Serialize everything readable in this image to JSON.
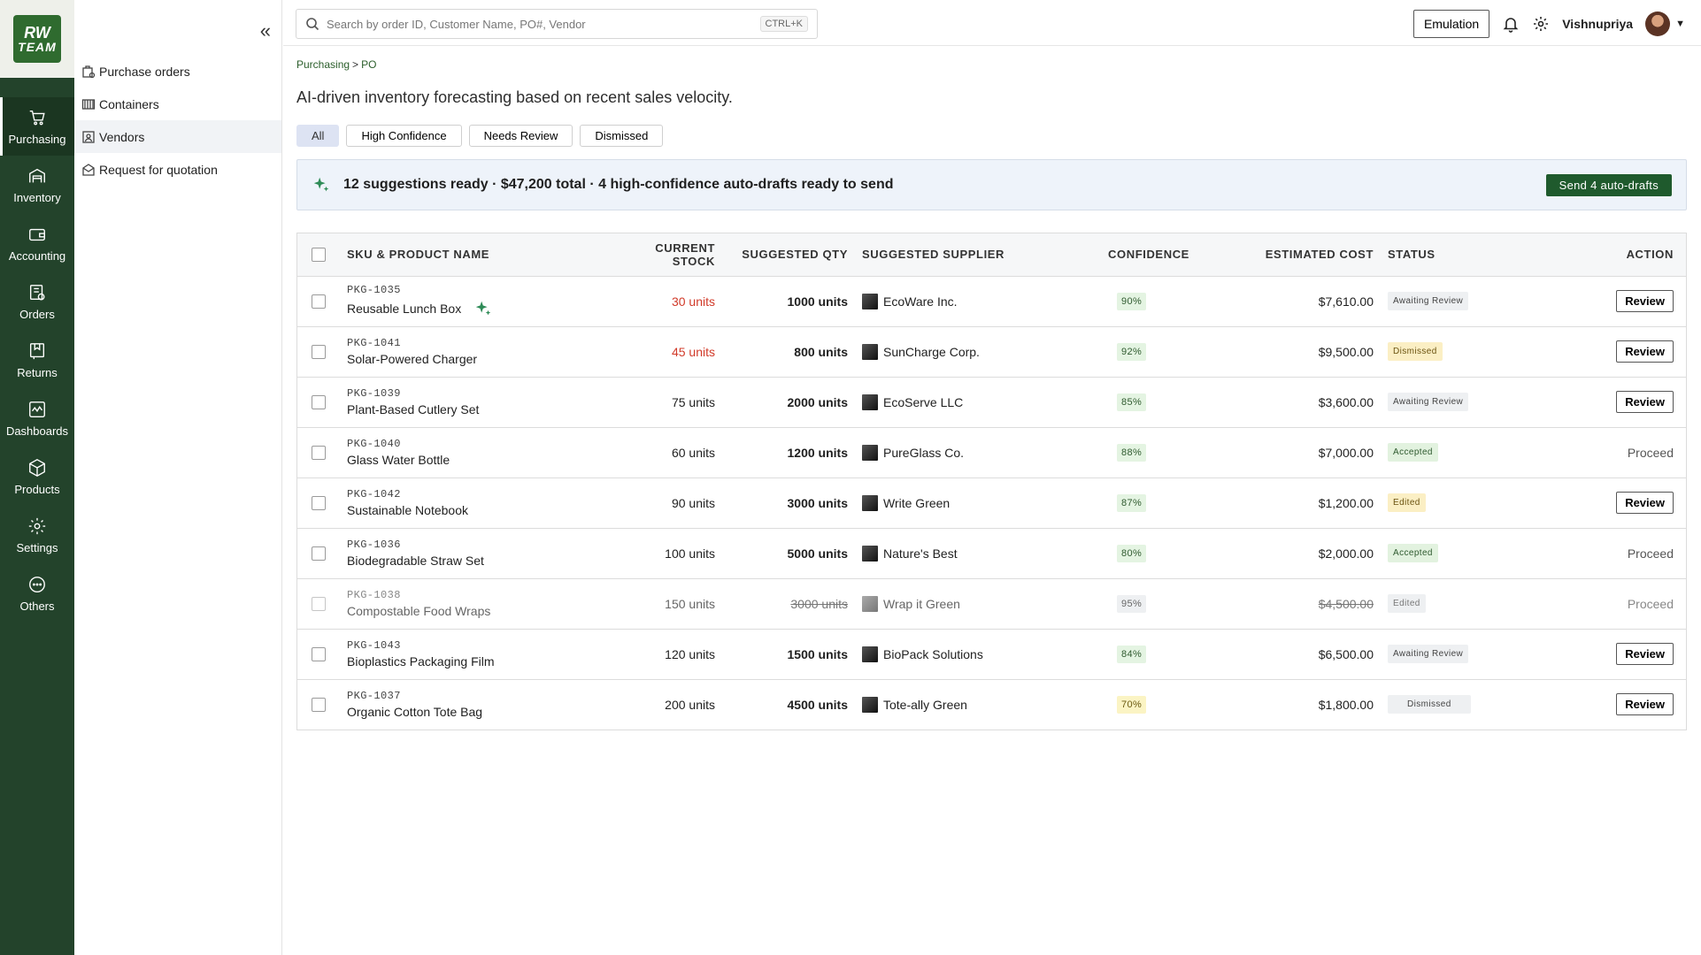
{
  "logo": {
    "line1": "RW",
    "line2": "TEAM"
  },
  "rail": [
    {
      "label": "Purchasing",
      "icon": "cart-icon",
      "active": true
    },
    {
      "label": "Inventory",
      "icon": "warehouse-icon"
    },
    {
      "label": "Accounting",
      "icon": "wallet-icon"
    },
    {
      "label": "Orders",
      "icon": "orders-icon"
    },
    {
      "label": "Returns",
      "icon": "returns-icon"
    },
    {
      "label": "Dashboards",
      "icon": "dashboard-icon"
    },
    {
      "label": "Products",
      "icon": "box-icon"
    },
    {
      "label": "Settings",
      "icon": "gear-icon"
    },
    {
      "label": "Others",
      "icon": "more-icon"
    }
  ],
  "subnav": [
    {
      "label": "Purchase orders",
      "icon": "purchase-orders-icon"
    },
    {
      "label": "Containers",
      "icon": "containers-icon"
    },
    {
      "label": "Vendors",
      "icon": "vendors-icon",
      "active": true
    },
    {
      "label": "Request for quotation",
      "icon": "quotation-icon"
    }
  ],
  "header": {
    "search_placeholder": "Search by order ID, Customer Name, PO#, Vendor",
    "shortcut": "CTRL+K",
    "emulation": "Emulation",
    "user": "Vishnupriya"
  },
  "breadcrumb": {
    "parent": "Purchasing",
    "separator": ">",
    "current": "PO"
  },
  "subtitle": "AI-driven inventory forecasting based on recent sales velocity.",
  "filters": [
    "All",
    "High Confidence",
    "Needs Review",
    "Dismissed"
  ],
  "banner": {
    "text": "12 suggestions ready · $47,200 total · 4 high-confidence auto-drafts ready to send",
    "button": "Send 4 auto-drafts"
  },
  "table": {
    "headers": [
      "SKU & PRODUCT NAME",
      "CURRENT STOCK",
      "SUGGESTED QTY",
      "SUGGESTED SUPPLIER",
      "CONFIDENCE",
      "ESTIMATED COST",
      "STATUS",
      "ACTION"
    ],
    "rows": [
      {
        "sku": "PKG-1035",
        "name": "Reusable Lunch Box",
        "stock": "30 units",
        "qty": "1000 units",
        "supplier": "EcoWare Inc.",
        "confidence": "90%",
        "cost": "$7,610.00",
        "status": "Awaiting Review",
        "action": "Review"
      },
      {
        "sku": "PKG-1041",
        "name": "Solar-Powered Charger",
        "stock": "45 units",
        "qty": "800 units",
        "supplier": "SunCharge Corp.",
        "confidence": "92%",
        "cost": "$9,500.00",
        "status": "Dismissed",
        "action": "Review"
      },
      {
        "sku": "PKG-1039",
        "name": "Plant-Based Cutlery Set",
        "stock": "75 units",
        "qty": "2000 units",
        "supplier": "EcoServe LLC",
        "confidence": "85%",
        "cost": "$3,600.00",
        "status": "Awaiting Review",
        "action": "Review"
      },
      {
        "sku": "PKG-1040",
        "name": "Glass Water Bottle",
        "stock": "60 units",
        "qty": "1200 units",
        "supplier": "PureGlass Co.",
        "confidence": "88%",
        "cost": "$7,000.00",
        "status": "Accepted",
        "action": "Proceed"
      },
      {
        "sku": "PKG-1042",
        "name": "Sustainable Notebook",
        "stock": "90 units",
        "qty": "3000 units",
        "supplier": "Write Green",
        "confidence": "87%",
        "cost": "$1,200.00",
        "status": "Edited",
        "action": "Review"
      },
      {
        "sku": "PKG-1036",
        "name": "Biodegradable Straw Set",
        "stock": "100 units",
        "qty": "5000 units",
        "supplier": "Nature's Best",
        "confidence": "80%",
        "cost": "$2,000.00",
        "status": "Accepted",
        "action": "Proceed"
      },
      {
        "sku": "PKG-1038",
        "name": "Compostable Food Wraps",
        "stock": "150 units",
        "qty": "3000 units",
        "supplier": "Wrap it Green",
        "confidence": "95%",
        "cost": "$4,500.00",
        "status": "Edited",
        "action": "Proceed"
      },
      {
        "sku": "PKG-1043",
        "name": "Bioplastics Packaging Film",
        "stock": "120 units",
        "qty": "1500 units",
        "supplier": "BioPack Solutions",
        "confidence": "84%",
        "cost": "$6,500.00",
        "status": "Awaiting Review",
        "action": "Review"
      },
      {
        "sku": "PKG-1037",
        "name": "Organic Cotton Tote Bag",
        "stock": "200 units",
        "qty": "4500 units",
        "supplier": "Tote-ally Green",
        "confidence": "70%",
        "cost": "$1,800.00",
        "status": "Dismissed",
        "action": "Review"
      }
    ]
  },
  "colors": {
    "rail": "#23432b",
    "accent": "#1f5a2d",
    "alert": "#d13b2a"
  }
}
